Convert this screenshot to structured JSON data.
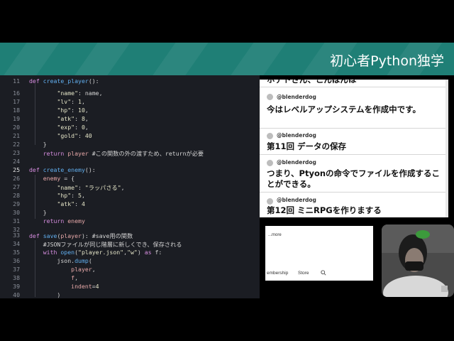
{
  "header": {
    "title": "初心者Python独学"
  },
  "editor": {
    "line_numbers": [
      "11",
      "16",
      "17",
      "18",
      "19",
      "20",
      "21",
      "22",
      "23",
      "24",
      "25",
      "26",
      "27",
      "28",
      "29",
      "30",
      "31",
      "32",
      "33",
      "34",
      "35",
      "36",
      "37",
      "38",
      "39",
      "40"
    ],
    "active_line": "25"
  },
  "chat": {
    "messages": [
      {
        "user": "",
        "text": "ホデトさん、こんばんは"
      },
      {
        "user": "@blenderdog",
        "text": "今はレベルアップシステムを作成中です。"
      },
      {
        "user": "@blenderdog",
        "text": "第11回 データの保存"
      },
      {
        "user": "@blenderdog",
        "text": "つまり、Ptyonの命令でファイルを作成することができる。"
      },
      {
        "user": "@blenderdog",
        "text": "第12回 ミニRPGを作りまする"
      }
    ]
  },
  "browser": {
    "more_label": "...more",
    "nav_items": [
      "embership",
      "Store"
    ]
  },
  "colors": {
    "header": "#1f7f76",
    "editor_bg": "#1b1d23",
    "keyword": "#d78ee0",
    "function": "#61afef"
  }
}
